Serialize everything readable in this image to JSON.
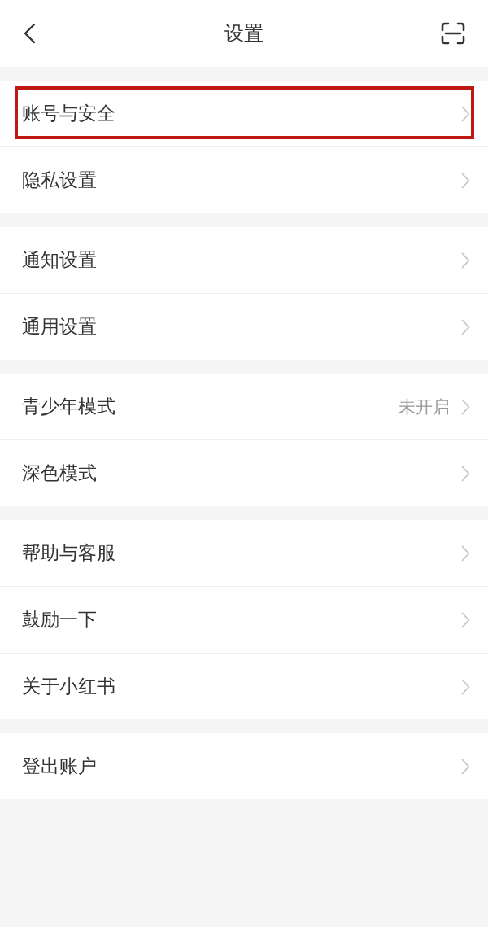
{
  "header": {
    "title": "设置"
  },
  "groups": [
    {
      "items": [
        {
          "label": "账号与安全",
          "highlighted": true
        },
        {
          "label": "隐私设置",
          "highlighted": false
        }
      ]
    },
    {
      "items": [
        {
          "label": "通知设置",
          "highlighted": false
        },
        {
          "label": "通用设置",
          "highlighted": false
        }
      ]
    },
    {
      "items": [
        {
          "label": "青少年模式",
          "value": "未开启",
          "highlighted": false
        },
        {
          "label": "深色模式",
          "highlighted": false
        }
      ]
    },
    {
      "items": [
        {
          "label": "帮助与客服",
          "highlighted": false
        },
        {
          "label": "鼓励一下",
          "highlighted": false
        },
        {
          "label": "关于小红书",
          "highlighted": false
        }
      ]
    },
    {
      "items": [
        {
          "label": "登出账户",
          "highlighted": false
        }
      ]
    }
  ]
}
